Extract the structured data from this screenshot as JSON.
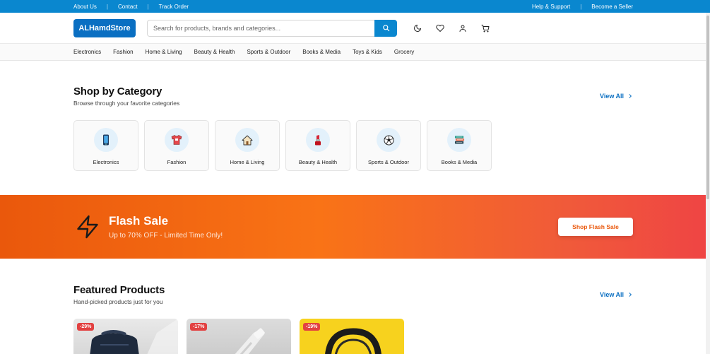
{
  "topbar": {
    "left_links": [
      "About Us",
      "Contact",
      "Track Order"
    ],
    "right_links": [
      "Help & Support",
      "Become a Seller"
    ],
    "separator": "|"
  },
  "header": {
    "logo": "ALHamdStore",
    "search_placeholder": "Search for products, brands and categories...",
    "icons": [
      "moon-icon",
      "heart-icon",
      "user-icon",
      "cart-icon"
    ]
  },
  "nav": {
    "items": [
      "Electronics",
      "Fashion",
      "Home & Living",
      "Beauty & Health",
      "Sports & Outdoor",
      "Books & Media",
      "Toys & Kids",
      "Grocery"
    ]
  },
  "categories_section": {
    "title": "Shop by Category",
    "subtitle": "Browse through your favorite categories",
    "view_all": "View All",
    "items": [
      {
        "label": "Electronics",
        "icon": "phone-icon"
      },
      {
        "label": "Fashion",
        "icon": "shirt-icon"
      },
      {
        "label": "Home & Living",
        "icon": "house-icon"
      },
      {
        "label": "Beauty & Health",
        "icon": "lipstick-icon"
      },
      {
        "label": "Sports & Outdoor",
        "icon": "soccer-ball-icon"
      },
      {
        "label": "Books & Media",
        "icon": "books-icon"
      }
    ]
  },
  "flash_sale": {
    "title": "Flash Sale",
    "subtitle": "Up to 70% OFF - Limited Time Only!",
    "button": "Shop Flash Sale"
  },
  "featured_section": {
    "title": "Featured Products",
    "subtitle": "Hand-picked products just for you",
    "view_all": "View All",
    "products": [
      {
        "discount": "-29%"
      },
      {
        "discount": "-17%"
      },
      {
        "discount": "-19%"
      }
    ]
  },
  "colors": {
    "primary": "#0a87cf",
    "logo_bg": "#0a6fc2",
    "flash_start": "#ea580c",
    "flash_end": "#ef4444",
    "badge": "#e24141"
  }
}
